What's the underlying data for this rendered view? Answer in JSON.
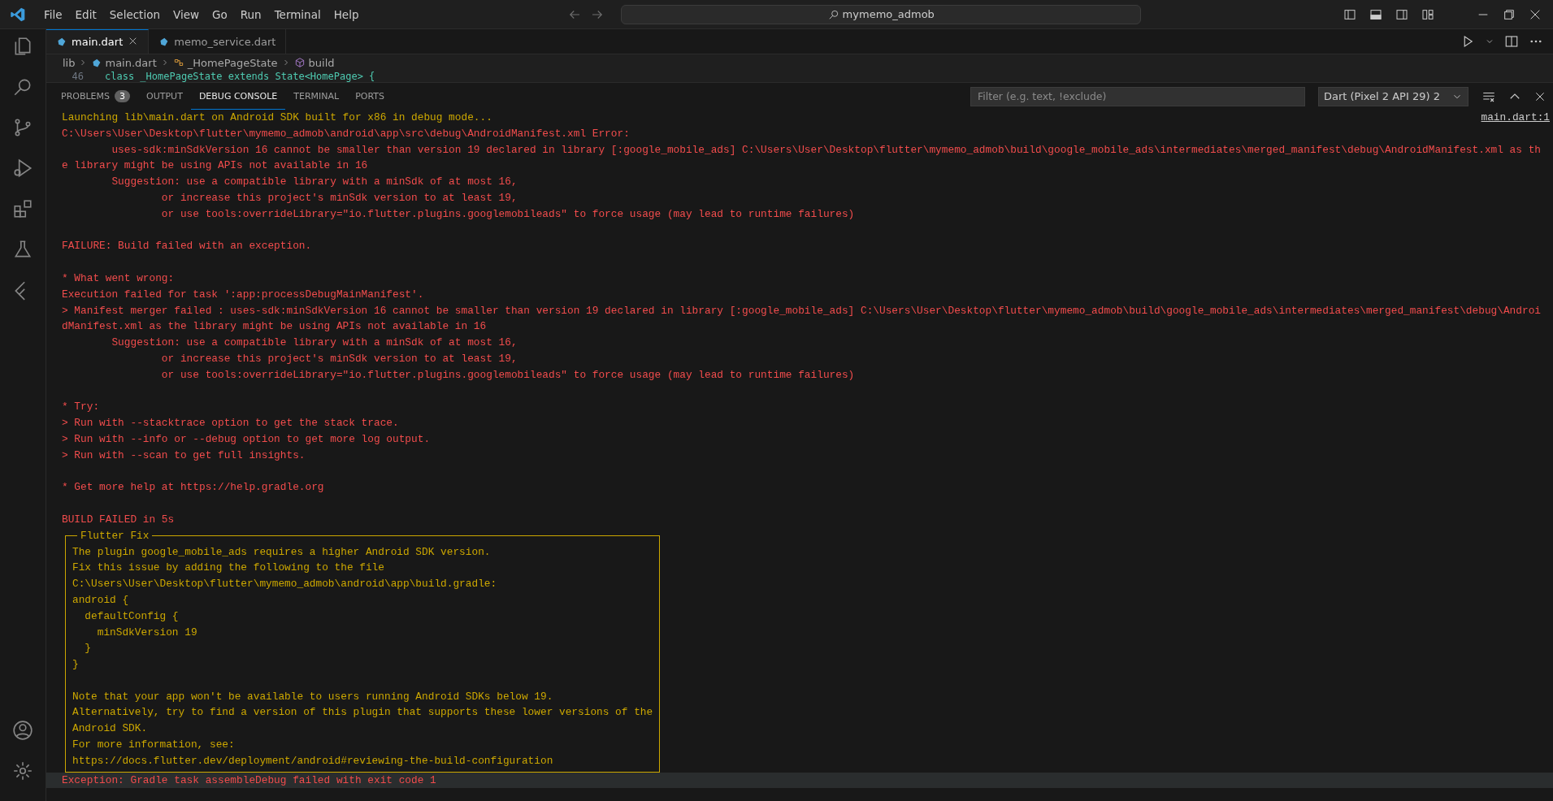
{
  "title_bar": {
    "menu": [
      "File",
      "Edit",
      "Selection",
      "View",
      "Go",
      "Run",
      "Terminal",
      "Help"
    ],
    "command_center": "mymemo_admob"
  },
  "editor_tabs": [
    {
      "label": "main.dart",
      "selected": true
    },
    {
      "label": "memo_service.dart",
      "selected": false
    }
  ],
  "breadcrumb": [
    "lib",
    "main.dart",
    "_HomePageState",
    "build"
  ],
  "code_line": {
    "number": "46",
    "text": "class _HomePageState extends State<HomePage> {"
  },
  "panel": {
    "tabs": [
      {
        "label": "PROBLEMS",
        "badge": "3",
        "selected": false
      },
      {
        "label": "OUTPUT",
        "selected": false
      },
      {
        "label": "DEBUG CONSOLE",
        "selected": true
      },
      {
        "label": "TERMINAL",
        "selected": false
      },
      {
        "label": "PORTS",
        "selected": false
      }
    ],
    "filter": {
      "placeholder": "Filter (e.g. text, !exclude)"
    },
    "session": "Dart (Pixel 2 API 29) 2"
  },
  "console": {
    "source_link": "main.dart:1",
    "lines": [
      {
        "kind": "info",
        "text": "Launching lib\\main.dart on Android SDK built for x86 in debug mode..."
      },
      {
        "kind": "error",
        "text": "C:\\Users\\User\\Desktop\\flutter\\mymemo_admob\\android\\app\\src\\debug\\AndroidManifest.xml Error:"
      },
      {
        "kind": "error",
        "text": "        uses-sdk:minSdkVersion 16 cannot be smaller than version 19 declared in library [:google_mobile_ads] C:\\Users\\User\\Desktop\\flutter\\mymemo_admob\\build\\google_mobile_ads\\intermediates\\merged_manifest\\debug\\AndroidManifest.xml as th"
      },
      {
        "kind": "error",
        "text": "e library might be using APIs not available in 16"
      },
      {
        "kind": "error",
        "text": "        Suggestion: use a compatible library with a minSdk of at most 16,"
      },
      {
        "kind": "error",
        "text": "                or increase this project's minSdk version to at least 19,"
      },
      {
        "kind": "error",
        "text": "                or use tools:overrideLibrary=\"io.flutter.plugins.googlemobileads\" to force usage (may lead to runtime failures)"
      },
      {
        "kind": "blank"
      },
      {
        "kind": "error",
        "text": "FAILURE: Build failed with an exception."
      },
      {
        "kind": "blank"
      },
      {
        "kind": "error",
        "text": "* What went wrong:"
      },
      {
        "kind": "error",
        "text": "Execution failed for task ':app:processDebugMainManifest'."
      },
      {
        "kind": "error",
        "text": "> Manifest merger failed : uses-sdk:minSdkVersion 16 cannot be smaller than version 19 declared in library [:google_mobile_ads] C:\\Users\\User\\Desktop\\flutter\\mymemo_admob\\build\\google_mobile_ads\\intermediates\\merged_manifest\\debug\\Androi"
      },
      {
        "kind": "error",
        "text": "dManifest.xml as the library might be using APIs not available in 16"
      },
      {
        "kind": "error",
        "text": "        Suggestion: use a compatible library with a minSdk of at most 16,"
      },
      {
        "kind": "error",
        "text": "                or increase this project's minSdk version to at least 19,"
      },
      {
        "kind": "error",
        "text": "                or use tools:overrideLibrary=\"io.flutter.plugins.googlemobileads\" to force usage (may lead to runtime failures)"
      },
      {
        "kind": "blank"
      },
      {
        "kind": "error",
        "text": "* Try:"
      },
      {
        "kind": "error",
        "text": "> Run with --stacktrace option to get the stack trace."
      },
      {
        "kind": "error",
        "text": "> Run with --info or --debug option to get more log output."
      },
      {
        "kind": "error",
        "text": "> Run with --scan to get full insights."
      },
      {
        "kind": "blank"
      },
      {
        "kind": "error",
        "text": "* Get more help at https://help.gradle.org"
      },
      {
        "kind": "blank"
      },
      {
        "kind": "error",
        "text": "BUILD FAILED in 5s"
      }
    ],
    "fix_box": {
      "title": "Flutter Fix",
      "lines": [
        {
          "kind": "text",
          "text": "The plugin google_mobile_ads requires a higher Android SDK version."
        },
        {
          "kind": "text",
          "text": "Fix this issue by adding the following to the file"
        },
        {
          "kind": "text",
          "text": "C:\\Users\\User\\Desktop\\flutter\\mymemo_admob\\android\\app\\build.gradle:"
        },
        {
          "kind": "text",
          "text": "android {"
        },
        {
          "kind": "text",
          "text": "  defaultConfig {"
        },
        {
          "kind": "text",
          "text": "    minSdkVersion 19"
        },
        {
          "kind": "text",
          "text": "  }"
        },
        {
          "kind": "text",
          "text": "}"
        },
        {
          "kind": "blank"
        },
        {
          "kind": "text",
          "text": "Note that your app won't be available to users running Android SDKs below 19."
        },
        {
          "kind": "text",
          "text": "Alternatively, try to find a version of this plugin that supports these lower versions of the"
        },
        {
          "kind": "text",
          "text": "Android SDK."
        },
        {
          "kind": "text",
          "text": "For more information, see:"
        },
        {
          "kind": "text",
          "text": "https://docs.flutter.dev/deployment/android#reviewing-the-build-configuration"
        }
      ]
    },
    "footer": {
      "kind": "error",
      "text": "Exception: Gradle task assembleDebug failed with exit code 1",
      "selected": true
    }
  }
}
